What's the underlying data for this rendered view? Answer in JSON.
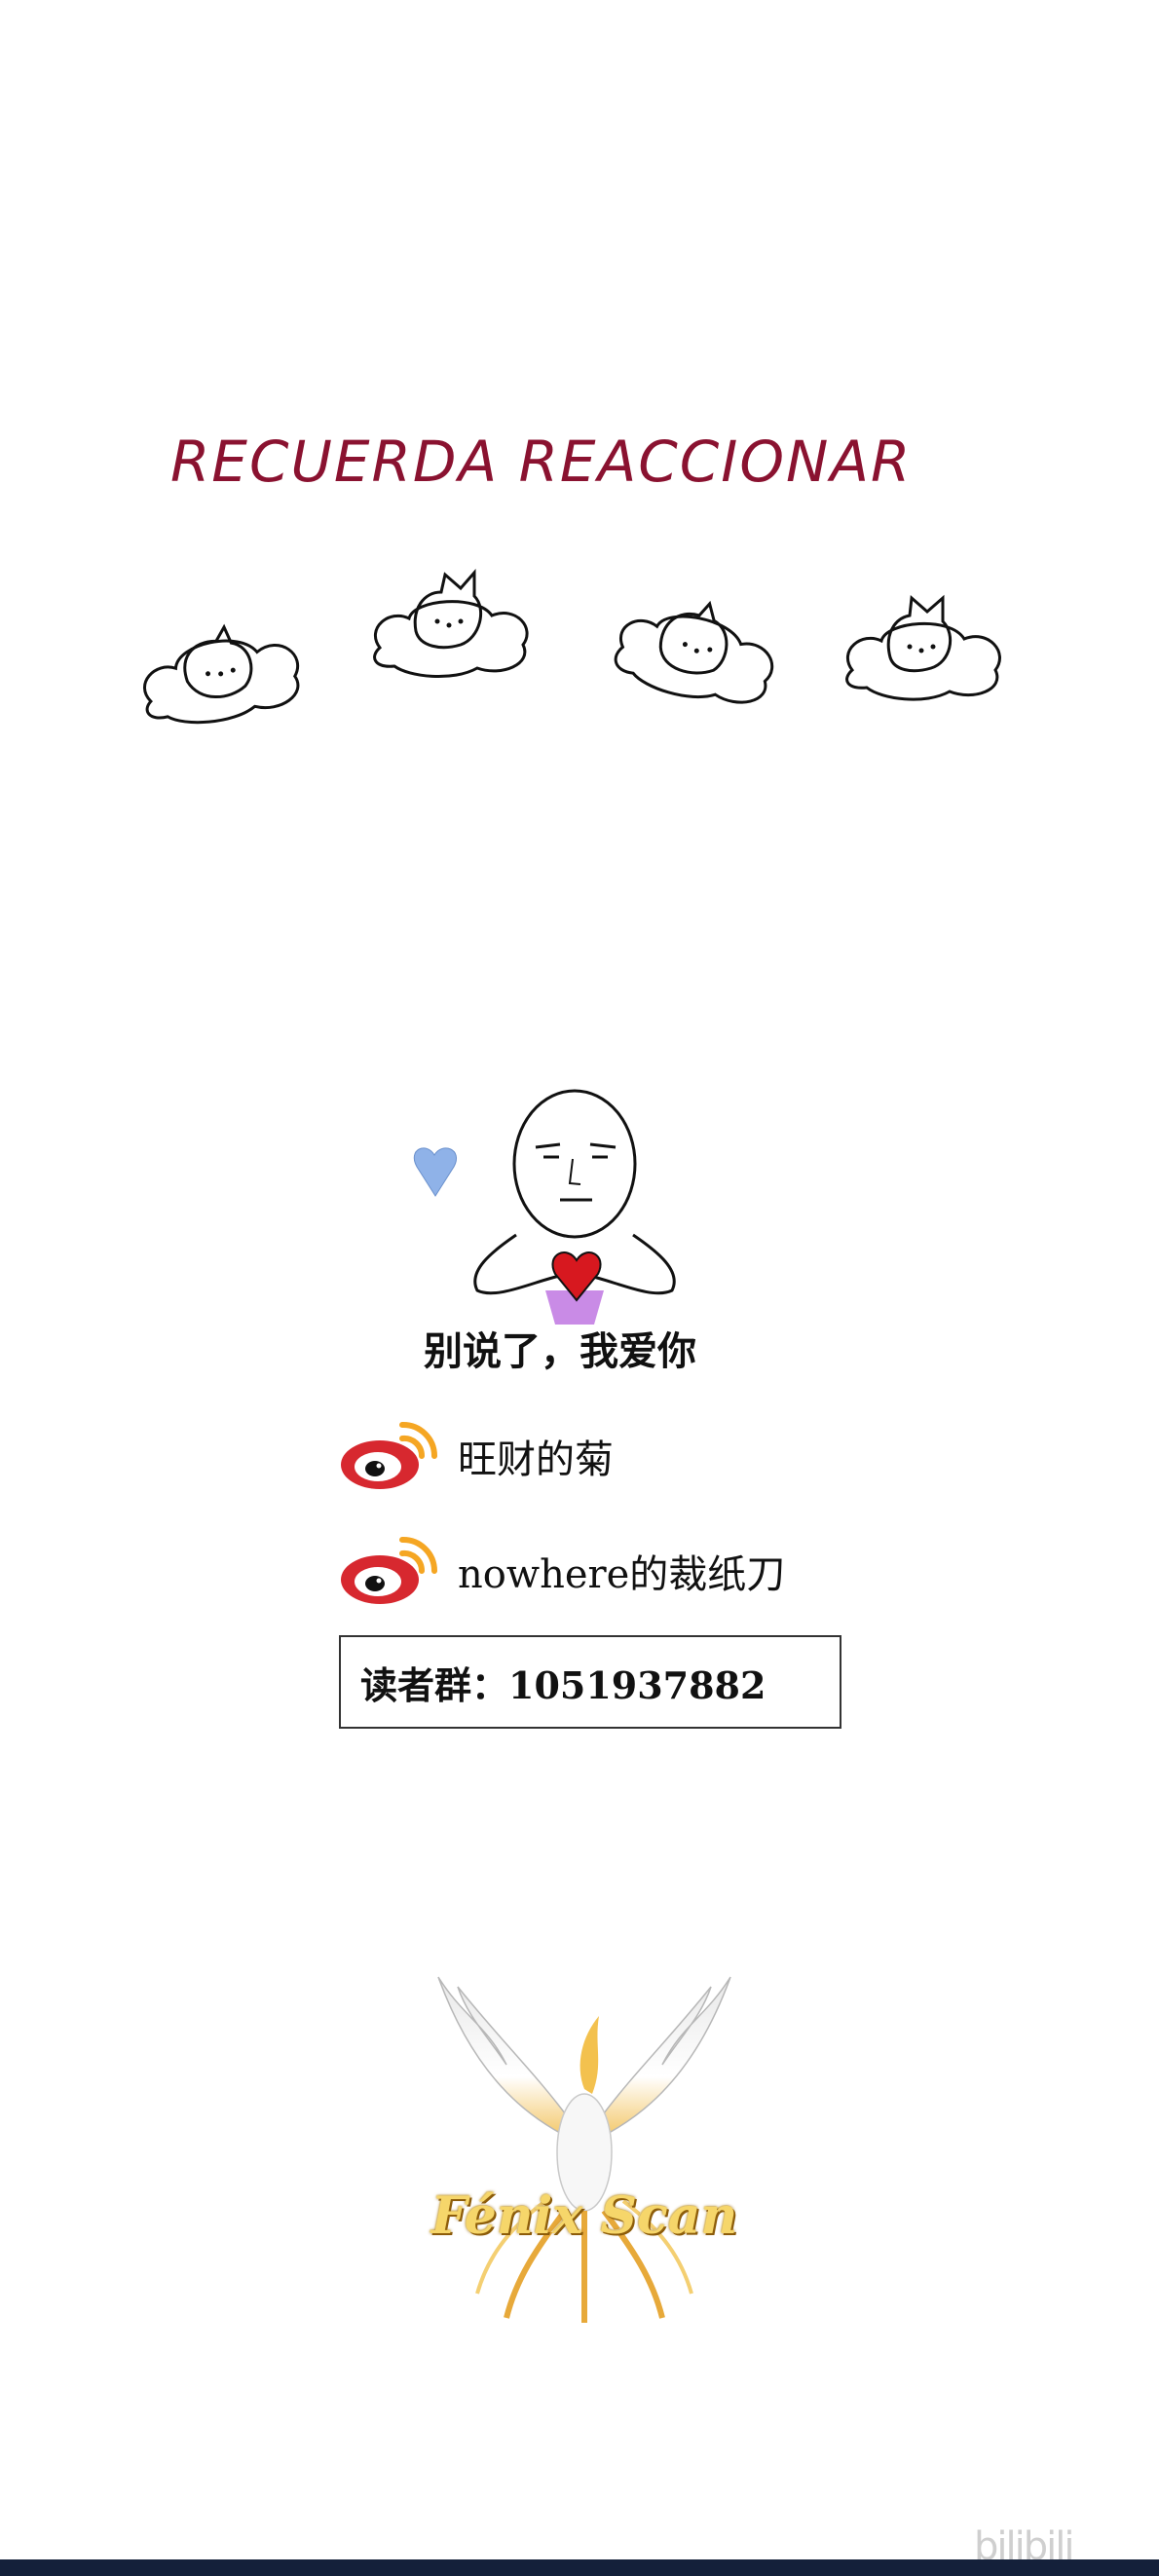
{
  "reminder": {
    "title": "RECUERDA REACCIONAR"
  },
  "reactions": [
    {
      "icon": "cat-cloud-icon"
    },
    {
      "icon": "cat-cloud-icon"
    },
    {
      "icon": "cat-cloud-icon"
    },
    {
      "icon": "cat-cloud-icon"
    }
  ],
  "meme": {
    "caption": "别说了，我爱你"
  },
  "social": [
    {
      "icon": "weibo-icon",
      "handle": "旺财的菊"
    },
    {
      "icon": "weibo-icon",
      "handle": "nowhere的裁纸刀"
    }
  ],
  "reader_group": {
    "text": "读者群：1051937882"
  },
  "logo": {
    "text": "Fénix Scan",
    "icon": "phoenix-icon"
  },
  "watermark": {
    "text": "bilibili"
  },
  "colors": {
    "title": "#8a1230",
    "weibo_red": "#d7282f",
    "weibo_orange": "#f5a623",
    "logo_gold": "#f6d66a"
  }
}
